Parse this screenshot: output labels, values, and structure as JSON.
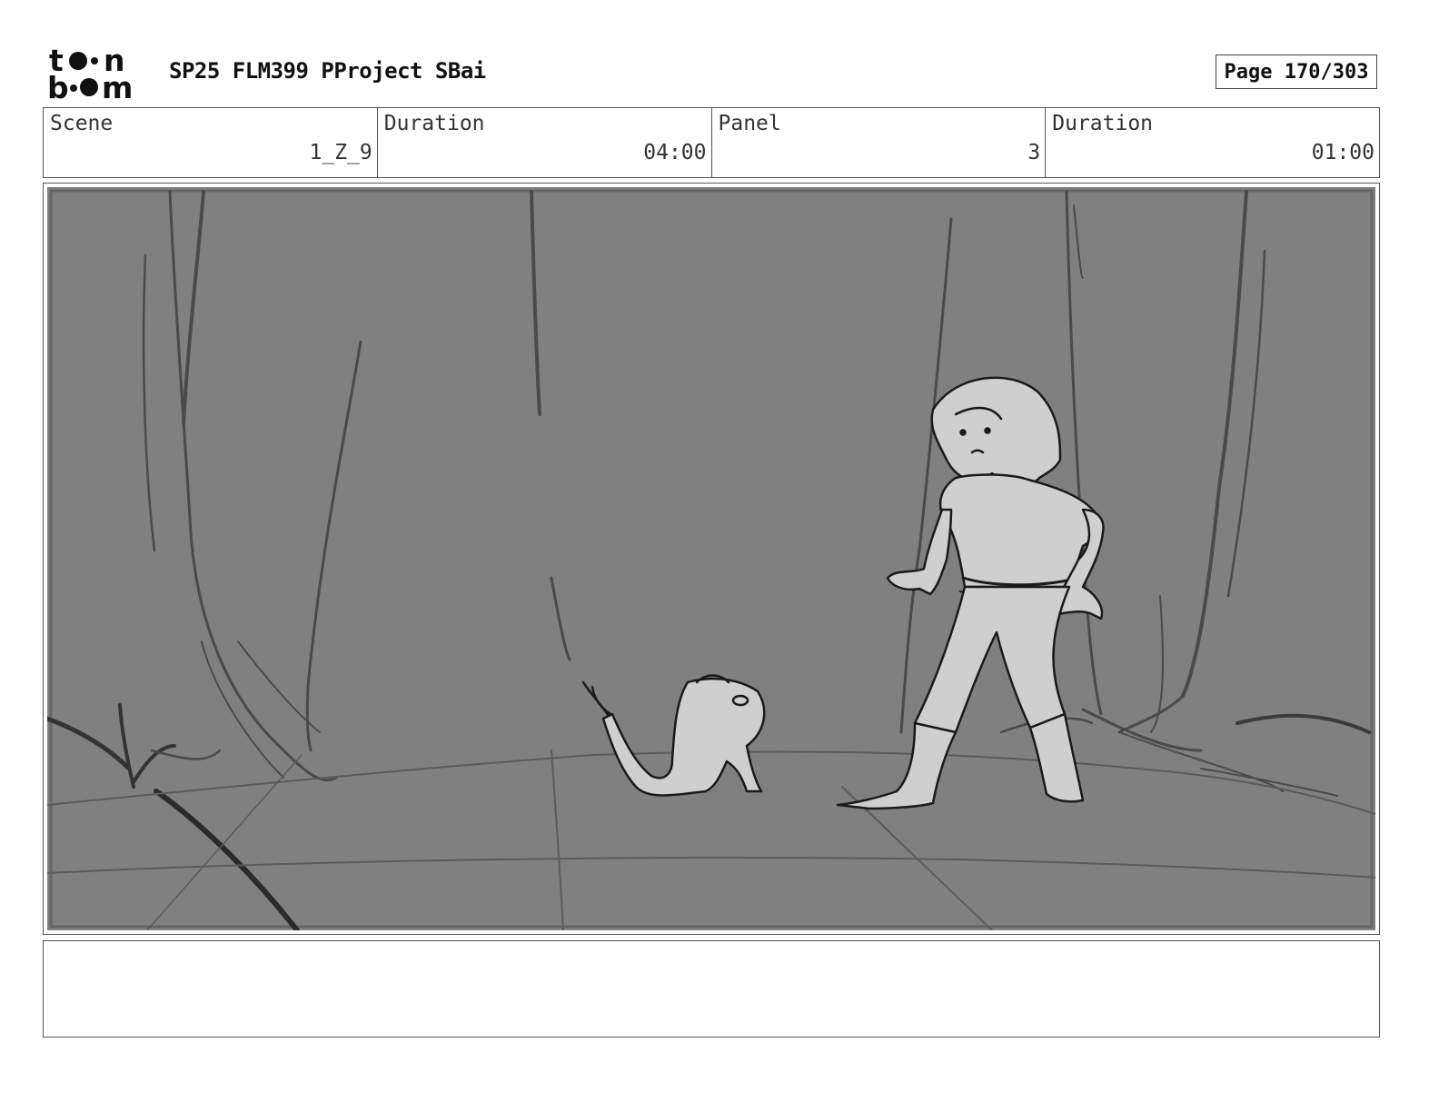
{
  "header": {
    "logo_text": "toon boom",
    "project_title": "SP25 FLM399 PProject SBai",
    "page_label": "Page 170/303"
  },
  "info": {
    "scene_label": "Scene",
    "scene_value": "1_Z_9",
    "duration_label": "Duration",
    "duration_value": "04:00",
    "panel_label": "Panel",
    "panel_value": "3",
    "panel_duration_label": "Duration",
    "panel_duration_value": "01:00"
  },
  "notes": {
    "text": ""
  }
}
